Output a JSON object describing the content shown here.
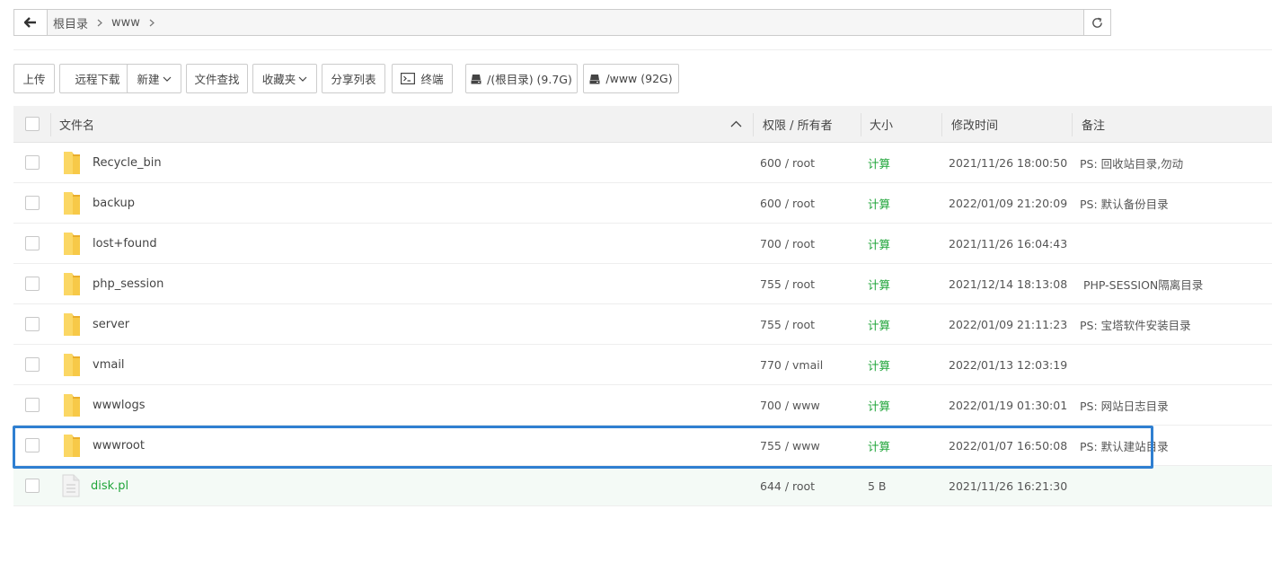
{
  "pathbar": {
    "crumbs": [
      {
        "label": "根目录"
      },
      {
        "label": "www"
      }
    ]
  },
  "toolbar": {
    "upload": "上传",
    "remote_download": "远程下载",
    "new": "新建",
    "file_search": "文件查找",
    "favorites": "收藏夹",
    "share_list": "分享列表",
    "terminal": "终端",
    "disk_root": "/(根目录) (9.7G)",
    "disk_www": "/www (92G)"
  },
  "table": {
    "headers": {
      "name": "文件名",
      "perm": "权限 / 所有者",
      "size": "大小",
      "mtime": "修改时间",
      "note": "备注"
    },
    "rows": [
      {
        "name": "Recycle_bin",
        "type": "folder",
        "perm": "600 / root",
        "size": "计算",
        "mtime": "2021/11/26 18:00:50",
        "note": "PS: 回收站目录,勿动"
      },
      {
        "name": "backup",
        "type": "folder",
        "perm": "600 / root",
        "size": "计算",
        "mtime": "2022/01/09 21:20:09",
        "note": "PS: 默认备份目录"
      },
      {
        "name": "lost+found",
        "type": "folder",
        "perm": "700 / root",
        "size": "计算",
        "mtime": "2021/11/26 16:04:43",
        "note": ""
      },
      {
        "name": "php_session",
        "type": "folder",
        "perm": "755 / root",
        "size": "计算",
        "mtime": "2021/12/14 18:13:08",
        "note": " PHP-SESSION隔离目录"
      },
      {
        "name": "server",
        "type": "folder",
        "perm": "755 / root",
        "size": "计算",
        "mtime": "2022/01/09 21:11:23",
        "note": "PS: 宝塔软件安装目录"
      },
      {
        "name": "vmail",
        "type": "folder",
        "perm": "770 / vmail",
        "size": "计算",
        "mtime": "2022/01/13 12:03:19",
        "note": ""
      },
      {
        "name": "wwwlogs",
        "type": "folder",
        "perm": "700 / www",
        "size": "计算",
        "mtime": "2022/01/19 01:30:01",
        "note": "PS: 网站日志目录"
      },
      {
        "name": "wwwroot",
        "type": "folder",
        "perm": "755 / www",
        "size": "计算",
        "mtime": "2022/01/07 16:50:08",
        "note": "PS: 默认建站目录"
      },
      {
        "name": "disk.pl",
        "type": "file",
        "perm": "644 / root",
        "size": "5 B",
        "mtime": "2021/11/26 16:21:30",
        "note": ""
      }
    ]
  },
  "colors": {
    "accent_green": "#20a53a",
    "selection_blue": "#2f7fd1",
    "folder_yellow": "#f7c948"
  }
}
